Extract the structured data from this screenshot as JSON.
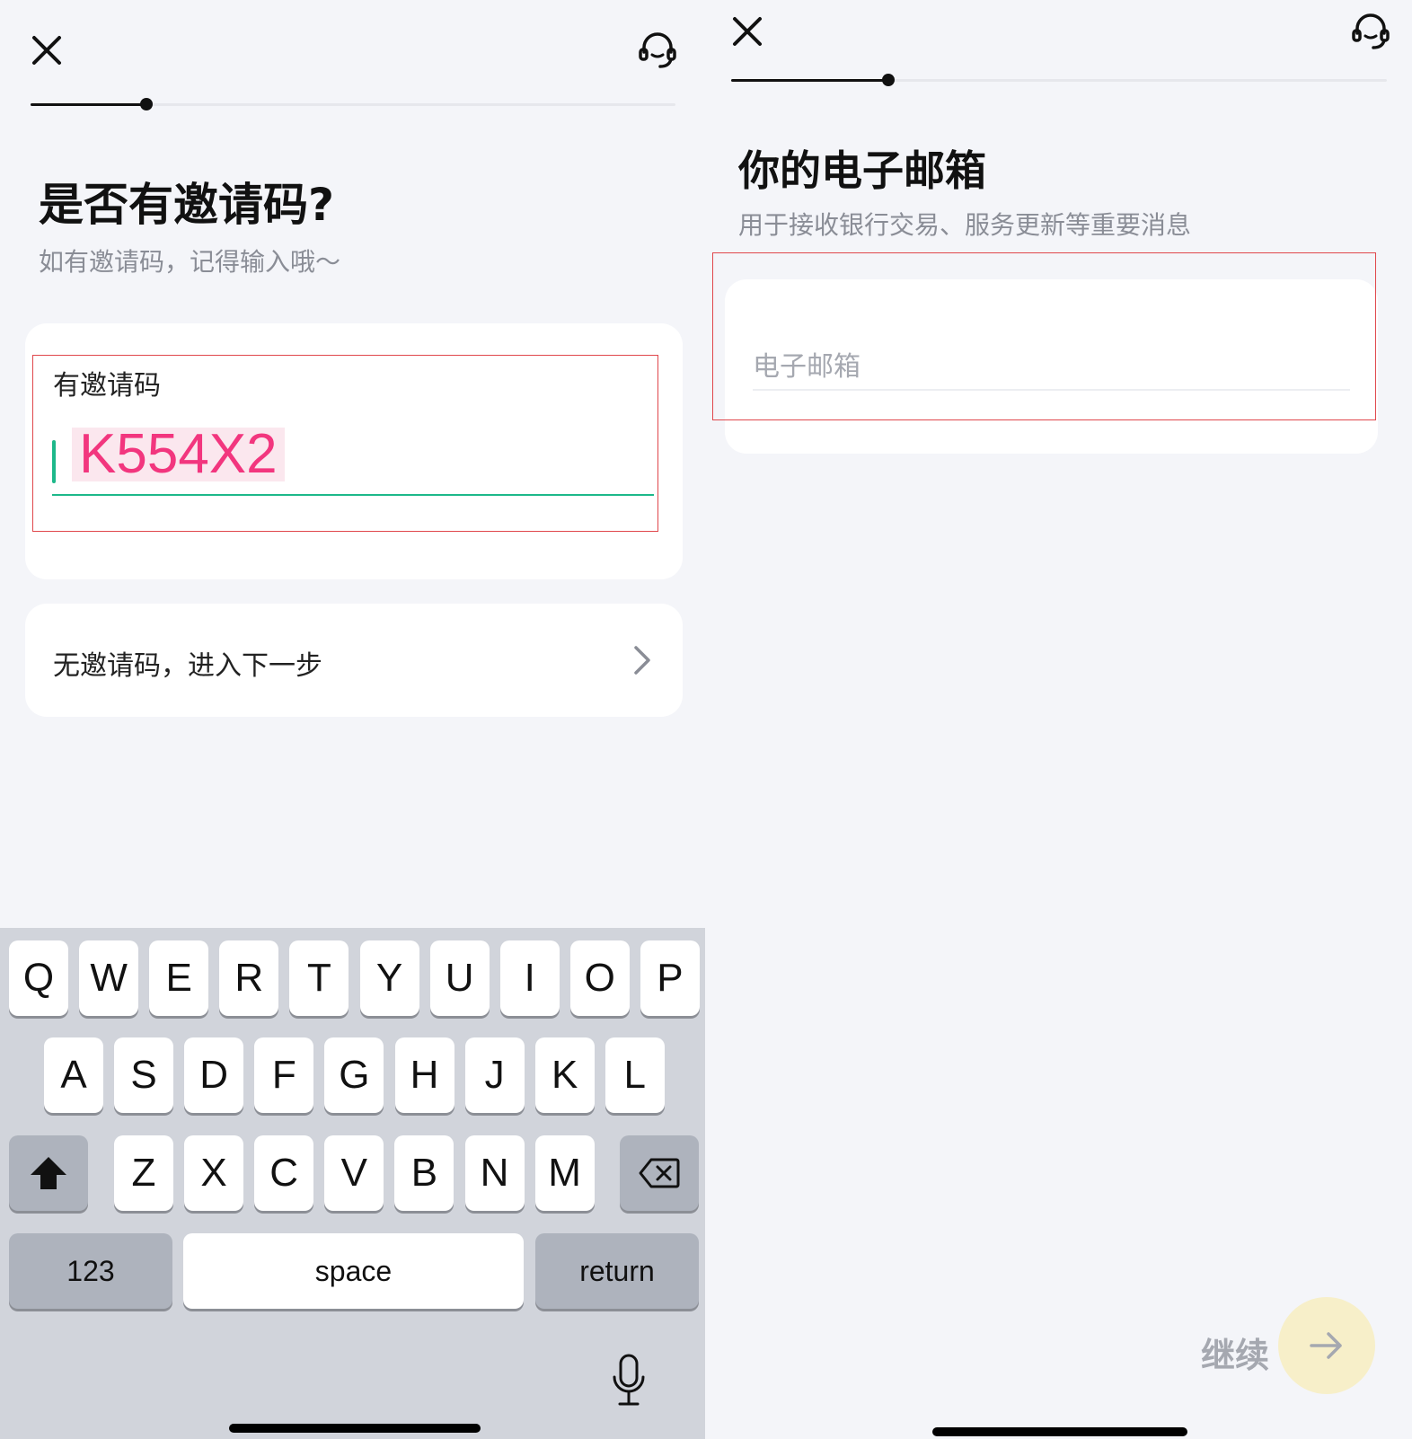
{
  "invite_screen": {
    "title": "是否有邀请码?",
    "subtitle": "如有邀请码，记得输入哦～",
    "invite_field_label": "有邀请码",
    "invite_code_value": "K554X2",
    "skip_option_label": "无邀请码，进入下一步",
    "progress": 0.18
  },
  "email_screen": {
    "title": "你的电子邮箱",
    "subtitle": "用于接收银行交易、服务更新等重要消息",
    "email_placeholder": "电子邮箱",
    "continue_label": "继续",
    "progress": 0.24
  },
  "keyboard": {
    "row1": [
      "Q",
      "W",
      "E",
      "R",
      "T",
      "Y",
      "U",
      "I",
      "O",
      "P"
    ],
    "row2": [
      "A",
      "S",
      "D",
      "F",
      "G",
      "H",
      "J",
      "K",
      "L"
    ],
    "row3": [
      "Z",
      "X",
      "C",
      "V",
      "B",
      "N",
      "M"
    ],
    "numbers_label": "123",
    "space_label": "space",
    "return_label": "return"
  },
  "colors": {
    "accent_pink": "#f2367e",
    "cursor_green": "#1db88a",
    "highlight_red": "#e0474c",
    "continue_button_bg": "#f7efc9"
  }
}
